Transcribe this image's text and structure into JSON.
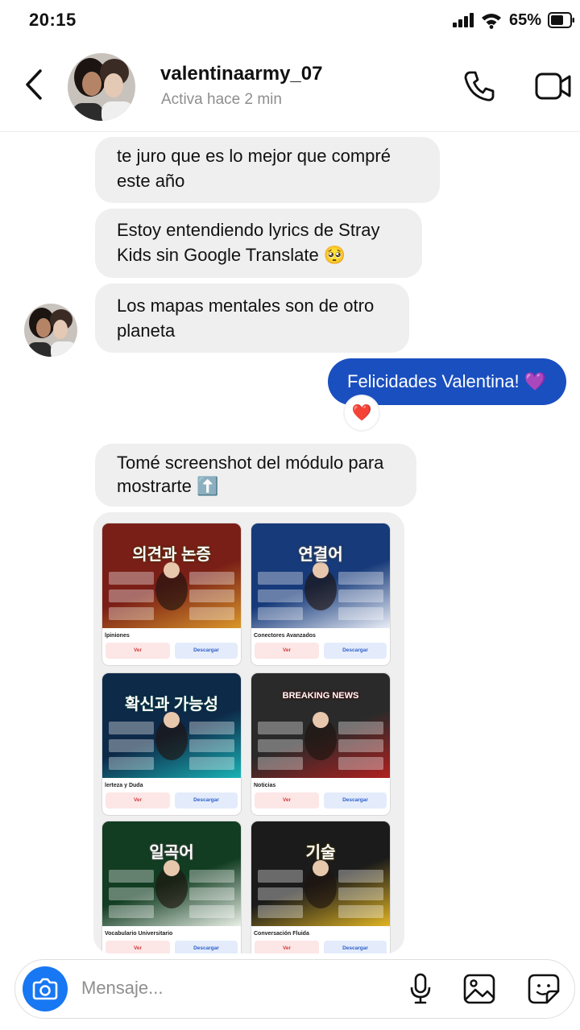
{
  "status_bar": {
    "time": "20:15",
    "battery_percent": "65%"
  },
  "header": {
    "username": "valentinaarmy_07",
    "status": "Activa hace 2 min"
  },
  "messages": [
    {
      "from": "them",
      "text": "te juro que es lo mejor que compré este año"
    },
    {
      "from": "them",
      "text": "Estoy entendiendo lyrics de Stray Kids sin Google Translate 🥺"
    },
    {
      "from": "them",
      "text": "Los mapas mentales son de otro planeta"
    },
    {
      "from": "me",
      "text": "Felicidades Valentina! 💜",
      "reaction": "❤️"
    },
    {
      "from": "them",
      "text": "Tomé screenshot del módulo para mostrarte ⬆️"
    }
  ],
  "screenshot_cards": [
    {
      "title": "lpiniones",
      "heading": "의견과 논증",
      "colors": [
        "#7a1f17",
        "#d9962a"
      ]
    },
    {
      "title": "Conectores Avanzados",
      "heading": "연결어",
      "colors": [
        "#163a7a",
        "#eaeef7"
      ]
    },
    {
      "title": "lerteza y Duda",
      "heading": "확신과 가능성",
      "colors": [
        "#0e2a49",
        "#1ab3b5"
      ]
    },
    {
      "title": "Noticias",
      "heading": "BREAKING NEWS",
      "colors": [
        "#2a2a2a",
        "#b02020"
      ]
    },
    {
      "title": "Vocabulario Universitario",
      "heading": "일곡어",
      "colors": [
        "#123d22",
        "#e9efe6"
      ]
    },
    {
      "title": "Conversación Fluida",
      "heading": "기술",
      "colors": [
        "#1b1b1b",
        "#e0b423"
      ]
    }
  ],
  "card_buttons": {
    "view": "Ver",
    "download": "Descargar"
  },
  "composer": {
    "placeholder": "Mensaje..."
  }
}
